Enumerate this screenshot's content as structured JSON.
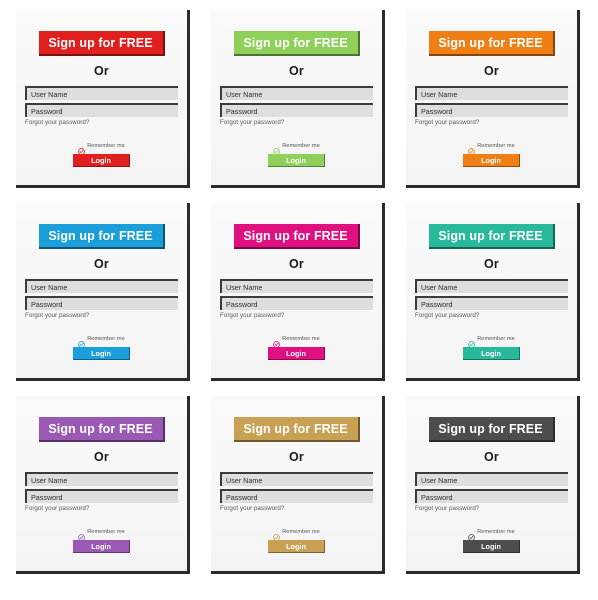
{
  "common": {
    "signup_label": "Sign up for FREE",
    "or_label": "Or",
    "username_placeholder": "User Name",
    "username_value": "User Name",
    "password_placeholder": "Password",
    "password_value": "Password",
    "forgot_label": "Forgot your password?",
    "remember_label": "Remember me",
    "login_label": "Login",
    "check_icon": "check-circle-icon",
    "field_bg": "#dedede",
    "field_border": "#3b3b3b",
    "card_bg": "#f7f7f7",
    "shadow_color": "#2b2b2b",
    "text_color": "#555555",
    "or_color": "#1b1b1b"
  },
  "cards": [
    {
      "id": "card-red",
      "color_name": "red",
      "accent": "#e01f1f",
      "signup_label": "Sign up for FREE",
      "or_label": "Or",
      "username_placeholder": "User Name",
      "username_value": "User Name",
      "password_placeholder": "Password",
      "password_value": "Password",
      "forgot_label": "Forgot your password?",
      "remember_label": "Remember me",
      "login_label": "Login"
    },
    {
      "id": "card-green",
      "color_name": "green",
      "accent": "#8ed05a",
      "signup_label": "Sign up for FREE",
      "or_label": "Or",
      "username_placeholder": "User Name",
      "username_value": "User Name",
      "password_placeholder": "Password",
      "password_value": "Password",
      "forgot_label": "Forgot your password?",
      "remember_label": "Remember me",
      "login_label": "Login"
    },
    {
      "id": "card-orange",
      "color_name": "orange",
      "accent": "#ef7e14",
      "signup_label": "Sign up for FREE",
      "or_label": "Or",
      "username_placeholder": "User Name",
      "username_value": "User Name",
      "password_placeholder": "Password",
      "password_value": "Password",
      "forgot_label": "Forgot your password?",
      "remember_label": "Remember me",
      "login_label": "Login"
    },
    {
      "id": "card-blue",
      "color_name": "blue",
      "accent": "#1a9fdb",
      "signup_label": "Sign up for FREE",
      "or_label": "Or",
      "username_placeholder": "User Name",
      "username_value": "User Name",
      "password_placeholder": "Password",
      "password_value": "Password",
      "forgot_label": "Forgot your password?",
      "remember_label": "Remember me",
      "login_label": "Login"
    },
    {
      "id": "card-pink",
      "color_name": "pink",
      "accent": "#e01080",
      "signup_label": "Sign up for FREE",
      "or_label": "Or",
      "username_placeholder": "User Name",
      "username_value": "User Name",
      "password_placeholder": "Password",
      "password_value": "Password",
      "forgot_label": "Forgot your password?",
      "remember_label": "Remember me",
      "login_label": "Login"
    },
    {
      "id": "card-teal",
      "color_name": "teal",
      "accent": "#28b99a",
      "signup_label": "Sign up for FREE",
      "or_label": "Or",
      "username_placeholder": "User Name",
      "username_value": "User Name",
      "password_placeholder": "Password",
      "password_value": "Password",
      "forgot_label": "Forgot your password?",
      "remember_label": "Remember me",
      "login_label": "Login"
    },
    {
      "id": "card-purple",
      "color_name": "purple",
      "accent": "#9b59b6",
      "signup_label": "Sign up for FREE",
      "or_label": "Or",
      "username_placeholder": "User Name",
      "username_value": "User Name",
      "password_placeholder": "Password",
      "password_value": "Password",
      "forgot_label": "Forgot your password?",
      "remember_label": "Remember me",
      "login_label": "Login"
    },
    {
      "id": "card-gold",
      "color_name": "gold",
      "accent": "#c9a council",
      "signup_label": "Sign up for FREE",
      "or_label": "Or",
      "username_placeholder": "User Name",
      "username_value": "User Name",
      "password_placeholder": "Password",
      "password_value": "Password",
      "forgot_label": "Forgot your password?",
      "remember_label": "Remember me",
      "login_label": "Login"
    },
    {
      "id": "card-darkgray",
      "color_name": "dark-gray",
      "accent": "#4d4d4d",
      "signup_label": "Sign up for FREE",
      "or_label": "Or",
      "username_placeholder": "User Name",
      "username_value": "User Name",
      "password_placeholder": "Password",
      "password_value": "Password",
      "forgot_label": "Forgot your password?",
      "remember_label": "Remember me",
      "login_label": "Login"
    }
  ]
}
